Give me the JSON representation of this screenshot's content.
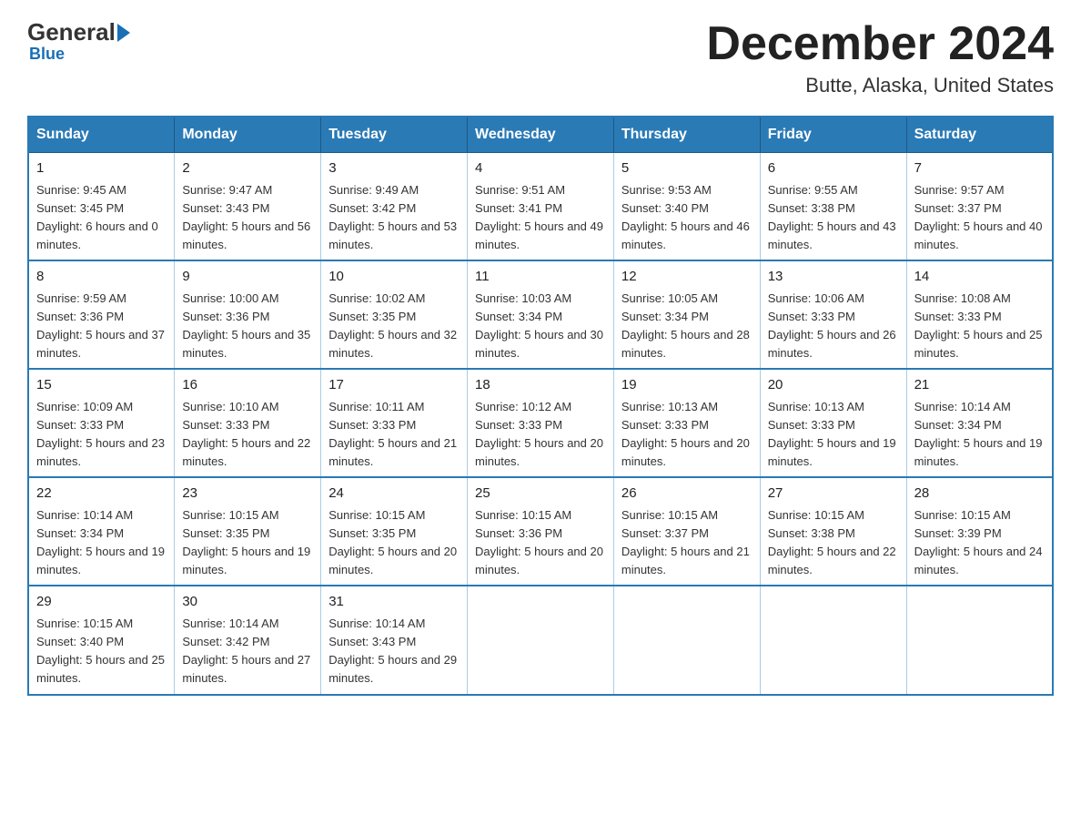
{
  "header": {
    "logo": {
      "part1": "General",
      "part2": "Blue"
    },
    "title": "December 2024",
    "location": "Butte, Alaska, United States"
  },
  "days_of_week": [
    "Sunday",
    "Monday",
    "Tuesday",
    "Wednesday",
    "Thursday",
    "Friday",
    "Saturday"
  ],
  "weeks": [
    [
      {
        "day": "1",
        "sunrise": "9:45 AM",
        "sunset": "3:45 PM",
        "daylight": "6 hours and 0 minutes."
      },
      {
        "day": "2",
        "sunrise": "9:47 AM",
        "sunset": "3:43 PM",
        "daylight": "5 hours and 56 minutes."
      },
      {
        "day": "3",
        "sunrise": "9:49 AM",
        "sunset": "3:42 PM",
        "daylight": "5 hours and 53 minutes."
      },
      {
        "day": "4",
        "sunrise": "9:51 AM",
        "sunset": "3:41 PM",
        "daylight": "5 hours and 49 minutes."
      },
      {
        "day": "5",
        "sunrise": "9:53 AM",
        "sunset": "3:40 PM",
        "daylight": "5 hours and 46 minutes."
      },
      {
        "day": "6",
        "sunrise": "9:55 AM",
        "sunset": "3:38 PM",
        "daylight": "5 hours and 43 minutes."
      },
      {
        "day": "7",
        "sunrise": "9:57 AM",
        "sunset": "3:37 PM",
        "daylight": "5 hours and 40 minutes."
      }
    ],
    [
      {
        "day": "8",
        "sunrise": "9:59 AM",
        "sunset": "3:36 PM",
        "daylight": "5 hours and 37 minutes."
      },
      {
        "day": "9",
        "sunrise": "10:00 AM",
        "sunset": "3:36 PM",
        "daylight": "5 hours and 35 minutes."
      },
      {
        "day": "10",
        "sunrise": "10:02 AM",
        "sunset": "3:35 PM",
        "daylight": "5 hours and 32 minutes."
      },
      {
        "day": "11",
        "sunrise": "10:03 AM",
        "sunset": "3:34 PM",
        "daylight": "5 hours and 30 minutes."
      },
      {
        "day": "12",
        "sunrise": "10:05 AM",
        "sunset": "3:34 PM",
        "daylight": "5 hours and 28 minutes."
      },
      {
        "day": "13",
        "sunrise": "10:06 AM",
        "sunset": "3:33 PM",
        "daylight": "5 hours and 26 minutes."
      },
      {
        "day": "14",
        "sunrise": "10:08 AM",
        "sunset": "3:33 PM",
        "daylight": "5 hours and 25 minutes."
      }
    ],
    [
      {
        "day": "15",
        "sunrise": "10:09 AM",
        "sunset": "3:33 PM",
        "daylight": "5 hours and 23 minutes."
      },
      {
        "day": "16",
        "sunrise": "10:10 AM",
        "sunset": "3:33 PM",
        "daylight": "5 hours and 22 minutes."
      },
      {
        "day": "17",
        "sunrise": "10:11 AM",
        "sunset": "3:33 PM",
        "daylight": "5 hours and 21 minutes."
      },
      {
        "day": "18",
        "sunrise": "10:12 AM",
        "sunset": "3:33 PM",
        "daylight": "5 hours and 20 minutes."
      },
      {
        "day": "19",
        "sunrise": "10:13 AM",
        "sunset": "3:33 PM",
        "daylight": "5 hours and 20 minutes."
      },
      {
        "day": "20",
        "sunrise": "10:13 AM",
        "sunset": "3:33 PM",
        "daylight": "5 hours and 19 minutes."
      },
      {
        "day": "21",
        "sunrise": "10:14 AM",
        "sunset": "3:34 PM",
        "daylight": "5 hours and 19 minutes."
      }
    ],
    [
      {
        "day": "22",
        "sunrise": "10:14 AM",
        "sunset": "3:34 PM",
        "daylight": "5 hours and 19 minutes."
      },
      {
        "day": "23",
        "sunrise": "10:15 AM",
        "sunset": "3:35 PM",
        "daylight": "5 hours and 19 minutes."
      },
      {
        "day": "24",
        "sunrise": "10:15 AM",
        "sunset": "3:35 PM",
        "daylight": "5 hours and 20 minutes."
      },
      {
        "day": "25",
        "sunrise": "10:15 AM",
        "sunset": "3:36 PM",
        "daylight": "5 hours and 20 minutes."
      },
      {
        "day": "26",
        "sunrise": "10:15 AM",
        "sunset": "3:37 PM",
        "daylight": "5 hours and 21 minutes."
      },
      {
        "day": "27",
        "sunrise": "10:15 AM",
        "sunset": "3:38 PM",
        "daylight": "5 hours and 22 minutes."
      },
      {
        "day": "28",
        "sunrise": "10:15 AM",
        "sunset": "3:39 PM",
        "daylight": "5 hours and 24 minutes."
      }
    ],
    [
      {
        "day": "29",
        "sunrise": "10:15 AM",
        "sunset": "3:40 PM",
        "daylight": "5 hours and 25 minutes."
      },
      {
        "day": "30",
        "sunrise": "10:14 AM",
        "sunset": "3:42 PM",
        "daylight": "5 hours and 27 minutes."
      },
      {
        "day": "31",
        "sunrise": "10:14 AM",
        "sunset": "3:43 PM",
        "daylight": "5 hours and 29 minutes."
      },
      null,
      null,
      null,
      null
    ]
  ]
}
